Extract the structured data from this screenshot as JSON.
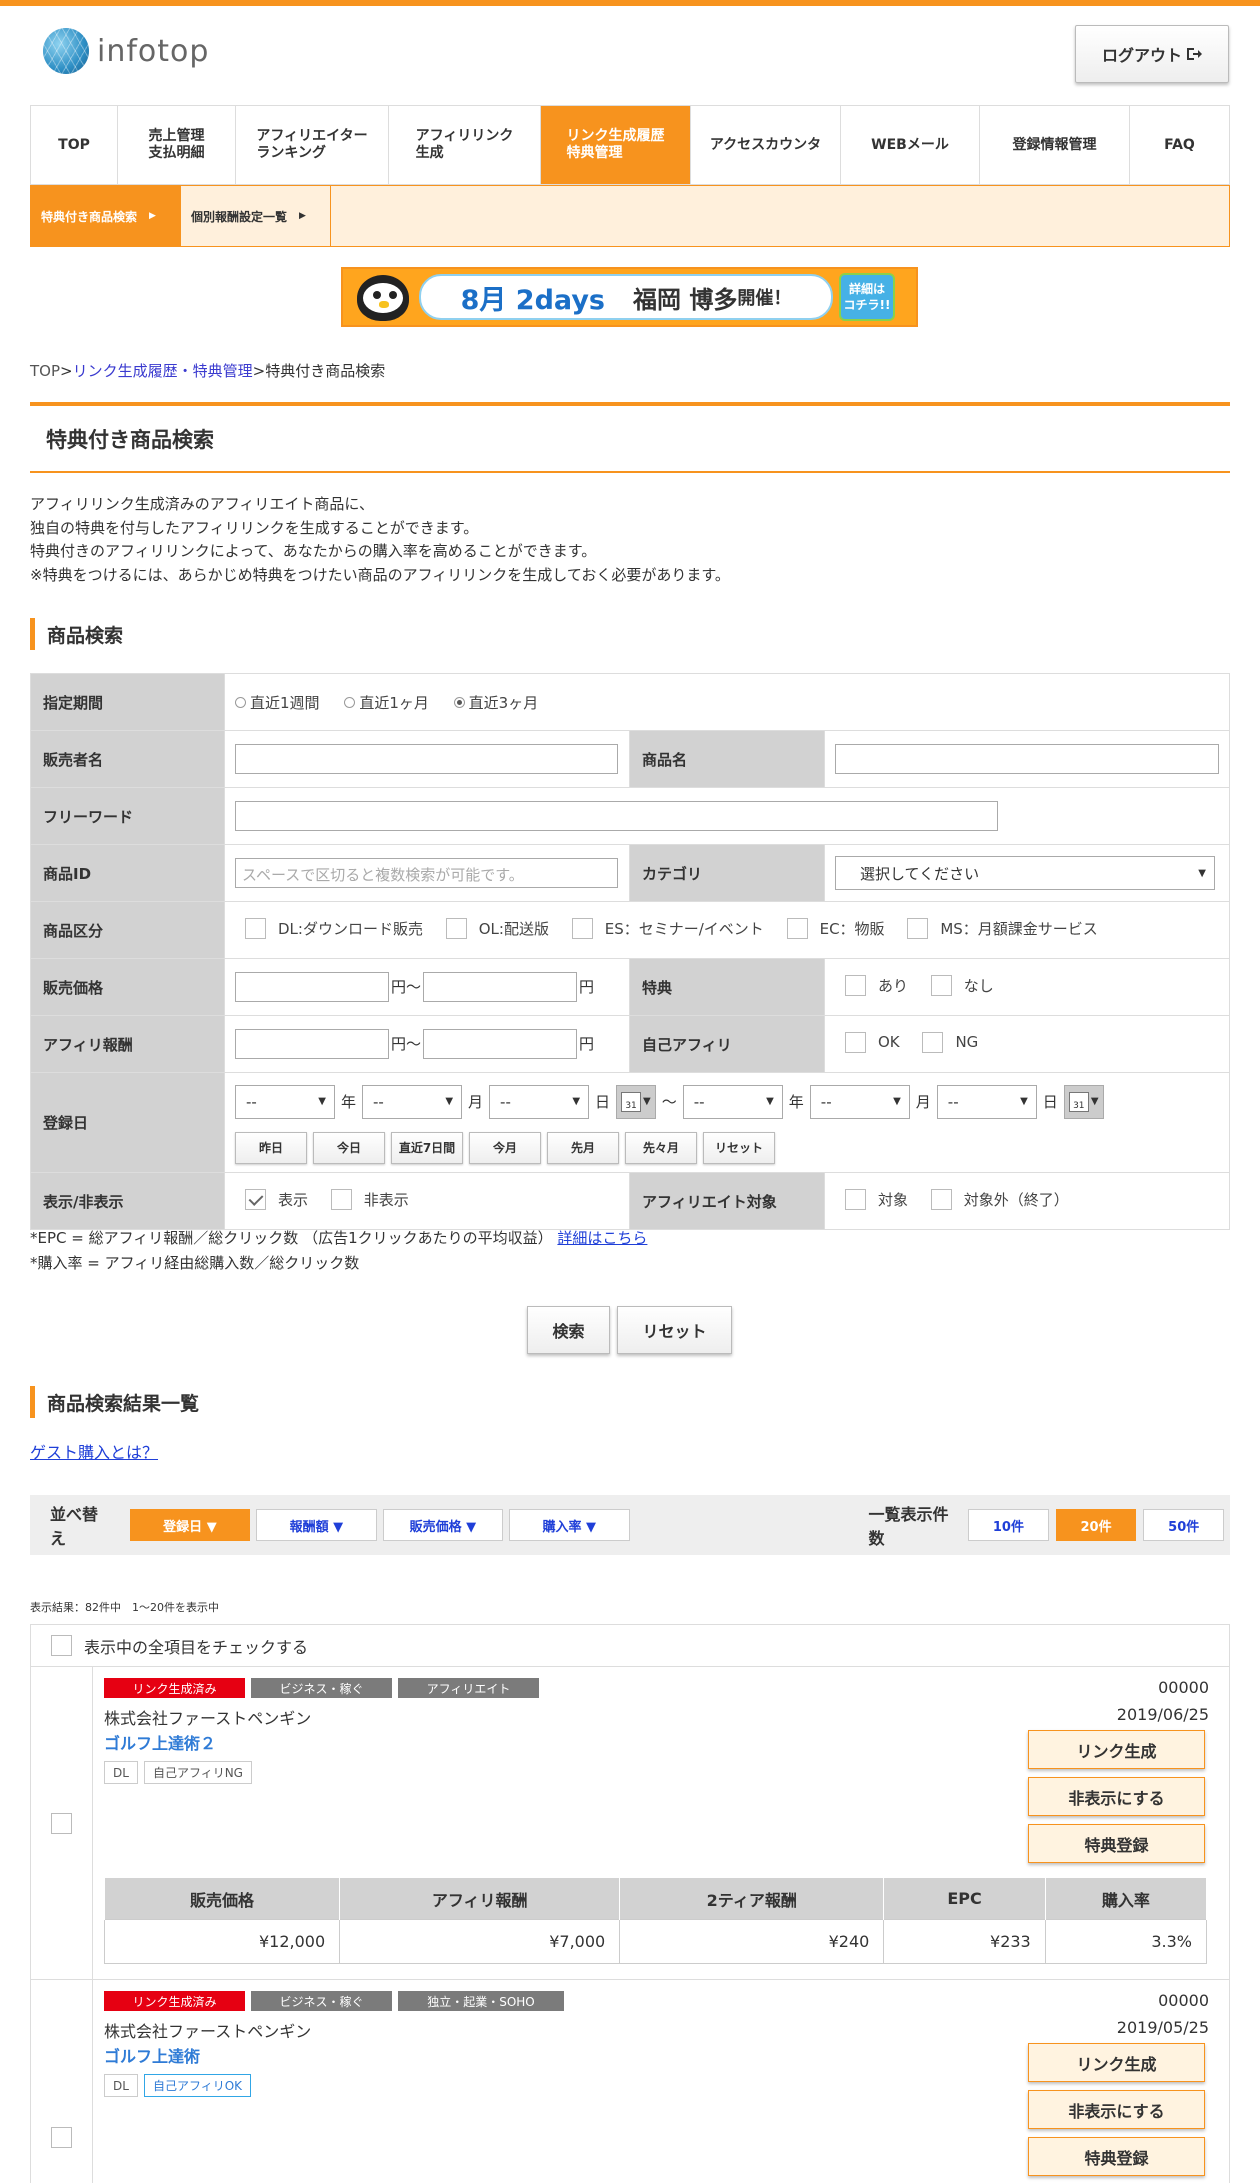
{
  "brand": {
    "logo_text": "infotop"
  },
  "header": {
    "logout": "ログアウト"
  },
  "nav": [
    {
      "label": "TOP"
    },
    {
      "label": "売上管理\n支払明細"
    },
    {
      "label": "アフィリエイター\nランキング"
    },
    {
      "label": "アフィリリンク\n生成"
    },
    {
      "label": "リンク生成履歴\n特典管理",
      "active": true
    },
    {
      "label": "アクセスカウンタ"
    },
    {
      "label": "WEBメール"
    },
    {
      "label": "登録情報管理"
    },
    {
      "label": "FAQ"
    }
  ],
  "subnav": [
    {
      "label": "特典付き商品検索",
      "active": true
    },
    {
      "label": "個別報酬設定一覧"
    }
  ],
  "banner": {
    "date": "8月 2days",
    "place": "福岡 博多",
    "suffix": "開催！",
    "cta": "詳細は\nコチラ!!"
  },
  "breadcrumb": {
    "home": "TOP",
    "parent": "リンク生成履歴・特典管理",
    "current": "特典付き商品検索",
    "sep": ">"
  },
  "page_title": "特典付き商品検索",
  "description": [
    "アフィリリンク生成済みのアフィリエイト商品に、",
    "独自の特典を付与したアフィリリンクを生成することができます。",
    "特典付きのアフィリリンクによって、あなたからの購入率を高めることができます。",
    "※特典をつけるには、あらかじめ特典をつけたい商品のアフィリリンクを生成しておく必要があります。"
  ],
  "search": {
    "heading": "商品検索",
    "period": {
      "label": "指定期間",
      "options": [
        "直近1週間",
        "直近1ヶ月",
        "直近3ヶ月"
      ],
      "selected": "直近3ヶ月"
    },
    "seller": {
      "label": "販売者名"
    },
    "product_name": {
      "label": "商品名"
    },
    "freeword": {
      "label": "フリーワード"
    },
    "product_id": {
      "label": "商品ID",
      "placeholder": "スペースで区切ると複数検索が可能です。"
    },
    "category": {
      "label": "カテゴリ",
      "value": "選択してください"
    },
    "type": {
      "label": "商品区分",
      "options": [
        "DL:ダウンロード販売",
        "OL:配送版",
        "ES：セミナー/イベント",
        "EC：物販",
        "MS：月額課金サービス"
      ]
    },
    "price": {
      "label": "販売価格",
      "from_unit": "円〜",
      "to_unit": "円"
    },
    "bonus": {
      "label": "特典",
      "options": [
        "あり",
        "なし"
      ]
    },
    "reward": {
      "label": "アフィリ報酬",
      "from_unit": "円〜",
      "to_unit": "円"
    },
    "self_affi": {
      "label": "自己アフィリ",
      "options": [
        "OK",
        "NG"
      ]
    },
    "regdate": {
      "label": "登録日",
      "dash": "--",
      "year": "年",
      "month": "月",
      "day": "日",
      "tilde": "〜",
      "cal_day": "31",
      "quick": [
        "昨日",
        "今日",
        "直近7日間",
        "今月",
        "先月",
        "先々月",
        "リセット"
      ]
    },
    "visibility": {
      "label": "表示/非表示",
      "options": [
        "表示",
        "非表示"
      ],
      "checked": "表示"
    },
    "target": {
      "label": "アフィリエイト対象",
      "options": [
        "対象",
        "対象外（終了）"
      ]
    }
  },
  "notes": {
    "epc": "*EPC = 総アフィリ報酬／総クリック数 （広告1クリックあたりの平均収益）",
    "epc_link": "詳細はこちら",
    "rate": "*購入率 = アフィリ経由総購入数／総クリック数"
  },
  "buttons": {
    "search": "検索",
    "reset": "リセット"
  },
  "results": {
    "heading": "商品検索結果一覧",
    "guest_link": "ゲスト購入とは？",
    "sort_label": "並べ替え",
    "sorts": [
      {
        "label": "登録日 ▼",
        "active": true
      },
      {
        "label": "報酬額 ▼"
      },
      {
        "label": "販売価格 ▼"
      },
      {
        "label": "購入率 ▼"
      }
    ],
    "perpage_label": "一覧表示件数",
    "perpage": [
      {
        "label": "10件"
      },
      {
        "label": "20件",
        "active": true
      },
      {
        "label": "50件"
      }
    ],
    "count": "表示結果：82件中　1〜20件を表示中",
    "check_all": "表示中の全項目をチェックする",
    "stat_headers": [
      "販売価格",
      "アフィリ報酬",
      "2ティア報酬",
      "EPC",
      "購入率"
    ],
    "actions": [
      "リンク生成",
      "非表示にする",
      "特典登録"
    ],
    "items": [
      {
        "tags": [
          "リンク生成済み",
          "ビジネス・稼ぐ",
          "アフィリエイト"
        ],
        "seller": "株式会社ファーストペンギン",
        "name": "ゴルフ上達術２",
        "badges": [
          "DL",
          "自己アフィリNG"
        ],
        "id": "00000",
        "date": "2019/06/25",
        "stats": [
          "¥12,000",
          "¥7,000",
          "¥240",
          "¥233",
          "3.3%"
        ]
      },
      {
        "tags": [
          "リンク生成済み",
          "ビジネス・稼ぐ",
          "独立・起業・SOHO"
        ],
        "seller": "株式会社ファーストペンギン",
        "name": "ゴルフ上達術",
        "badges": [
          "DL",
          "自己アフィリOK"
        ],
        "id": "00000",
        "date": "2019/05/25"
      }
    ]
  },
  "colors": {
    "accent": "#f7931e",
    "link": "#1f3fd8",
    "tag_red": "#e60012",
    "tag_gray": "#7b7b7b"
  }
}
